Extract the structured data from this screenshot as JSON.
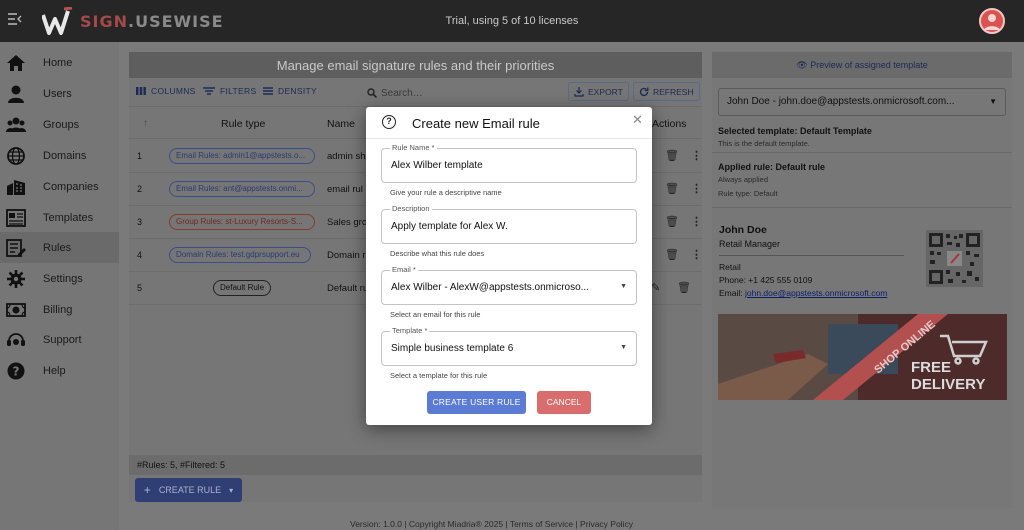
{
  "app": {
    "brand_part1": "SIGN",
    "brand_part2": ".USEWISE",
    "license_status": "Trial, using 5 of 10 licenses"
  },
  "sidebar": {
    "items": [
      {
        "label": "Home",
        "icon": "home-icon"
      },
      {
        "label": "Users",
        "icon": "user-icon"
      },
      {
        "label": "Groups",
        "icon": "groups-icon"
      },
      {
        "label": "Domains",
        "icon": "globe-icon"
      },
      {
        "label": "Companies",
        "icon": "building-icon"
      },
      {
        "label": "Templates",
        "icon": "template-icon"
      },
      {
        "label": "Rules",
        "icon": "rules-icon",
        "active": true
      },
      {
        "label": "Settings",
        "icon": "gear-icon"
      },
      {
        "label": "Billing",
        "icon": "money-icon"
      },
      {
        "label": "Support",
        "icon": "headset-icon"
      },
      {
        "label": "Help",
        "icon": "help-icon"
      }
    ]
  },
  "main": {
    "title": "Manage email signature rules and their priorities",
    "toolbar": {
      "columns": "COLUMNS",
      "filters": "FILTERS",
      "density": "DENSITY",
      "search_placeholder": "Search…",
      "export": "EXPORT",
      "refresh": "REFRESH"
    },
    "columns": {
      "rule_type": "Rule type",
      "name": "Name",
      "actions": "Actions"
    },
    "rows": [
      {
        "num": "1",
        "rule": "Email Rules: admin1@appstests.o...",
        "rule_color": "#3a4f8a",
        "name": "admin sh"
      },
      {
        "num": "2",
        "rule": "Email Rules: ant@appstests.onmi...",
        "rule_color": "#3a4f8a",
        "name": "email rul"
      },
      {
        "num": "3",
        "rule": "Group Rules: st-Luxury Resorts-S...",
        "rule_color": "#8a3a2a",
        "name": "Sales gro"
      },
      {
        "num": "4",
        "rule": "Domain Rules: test.gdprsupport.eu",
        "rule_color": "#3a4f8a",
        "name": "Domain r"
      },
      {
        "num": "5",
        "rule": "Default Rule",
        "rule_color": "#222222",
        "name": "Default ru"
      }
    ],
    "footer": "#Rules: 5, #Filtered: 5",
    "create_button": "CREATE RULE"
  },
  "right_panel": {
    "preview_link": "Preview of assigned template",
    "user_select": "John Doe - john.doe@appstests.onmicrosoft.com...",
    "selected_template_label": "Selected template: Default Template",
    "selected_template_desc": "This is the default template.",
    "applied_rule_label": "Applied rule: Default rule",
    "applied_rule_desc": "Always applied",
    "rule_type": "Rule type: Default",
    "signature": {
      "name": "John Doe",
      "title": "Retail Manager",
      "department": "Retail",
      "phone": "Phone: +1 425 555 0109",
      "email_label": "Email:",
      "email": "john.doe@appstests.onmicrosoft.com"
    },
    "banner": {
      "ribbon": "SHOP ONLINE",
      "line1": "FREE",
      "line2": "DELIVERY"
    }
  },
  "page_footer": "Version: 1.0.0  |  Copyright Miadria® 2025  |  Terms of Service  |  Privacy Policy",
  "dialog": {
    "title": "Create new Email rule",
    "fields": {
      "rule_name": {
        "label": "Rule Name *",
        "value": "Alex Wilber template",
        "helper": "Give your rule a descriptive name"
      },
      "description": {
        "label": "Description",
        "value": "Apply template for Alex W.",
        "helper": "Describe what this rule does"
      },
      "email": {
        "label": "Email *",
        "value": "Alex Wilber - AlexW@appstests.onmicroso...",
        "helper": "Select an email for this rule"
      },
      "template": {
        "label": "Template *",
        "value": "Simple business template 6",
        "helper": "Select a template for this rule"
      }
    },
    "create_button": "CREATE USER RULE",
    "cancel_button": "CANCEL"
  }
}
